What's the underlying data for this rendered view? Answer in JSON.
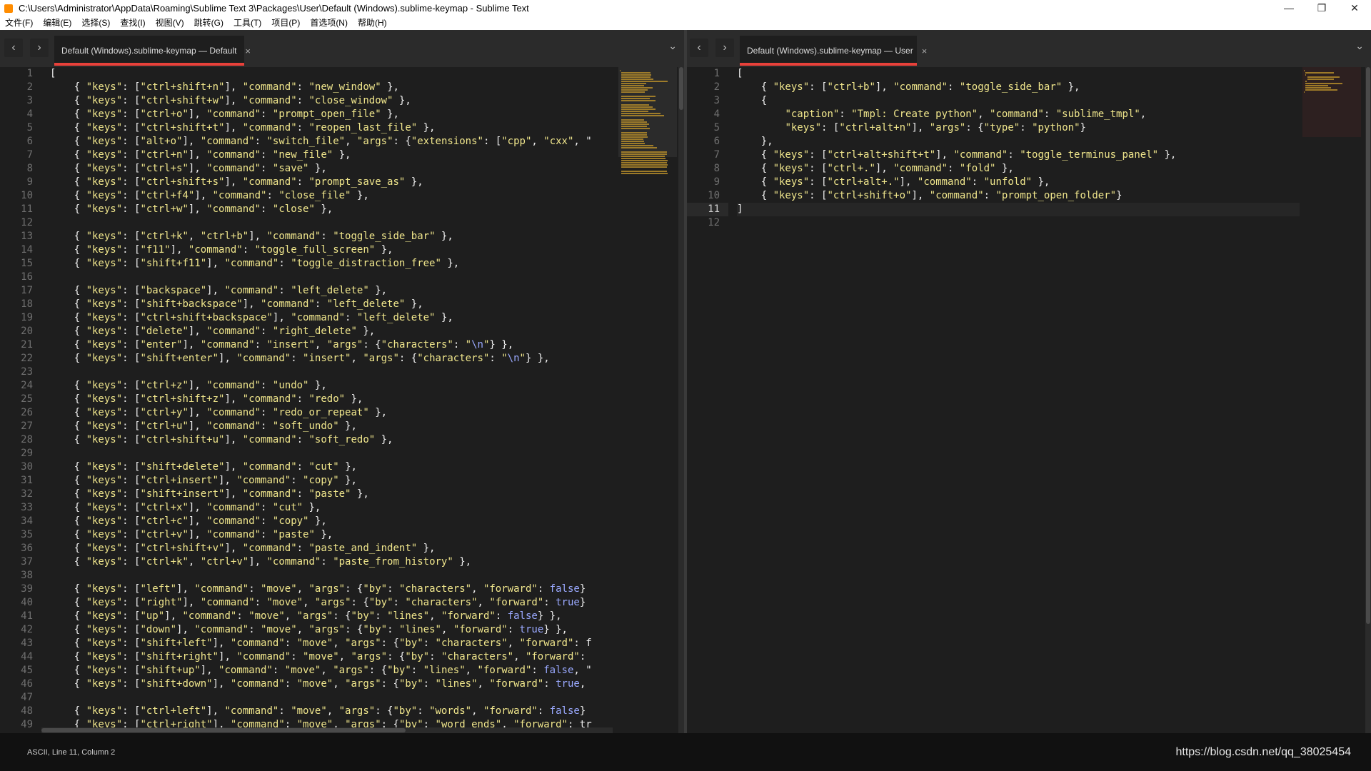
{
  "window": {
    "title": "C:\\Users\\Administrator\\AppData\\Roaming\\Sublime Text 3\\Packages\\User\\Default (Windows).sublime-keymap - Sublime Text",
    "controls": {
      "minimize": "—",
      "restore": "❐",
      "close": "✕"
    }
  },
  "menu": [
    "文件(F)",
    "编辑(E)",
    "选择(S)",
    "查找(I)",
    "视图(V)",
    "跳转(G)",
    "工具(T)",
    "项目(P)",
    "首选项(N)",
    "帮助(H)"
  ],
  "left_tab": {
    "label": "Default (Windows).sublime-keymap — Default",
    "close": "×"
  },
  "right_tab": {
    "label": "Default (Windows).sublime-keymap — User",
    "close": "×"
  },
  "nav": {
    "back": "‹",
    "forward": "›",
    "dropdown": "⌄"
  },
  "left_code": [
    "[",
    "    { \"keys\": [\"ctrl+shift+n\"], \"command\": \"new_window\" },",
    "    { \"keys\": [\"ctrl+shift+w\"], \"command\": \"close_window\" },",
    "    { \"keys\": [\"ctrl+o\"], \"command\": \"prompt_open_file\" },",
    "    { \"keys\": [\"ctrl+shift+t\"], \"command\": \"reopen_last_file\" },",
    "    { \"keys\": [\"alt+o\"], \"command\": \"switch_file\", \"args\": {\"extensions\": [\"cpp\", \"cxx\", \"",
    "    { \"keys\": [\"ctrl+n\"], \"command\": \"new_file\" },",
    "    { \"keys\": [\"ctrl+s\"], \"command\": \"save\" },",
    "    { \"keys\": [\"ctrl+shift+s\"], \"command\": \"prompt_save_as\" },",
    "    { \"keys\": [\"ctrl+f4\"], \"command\": \"close_file\" },",
    "    { \"keys\": [\"ctrl+w\"], \"command\": \"close\" },",
    "",
    "    { \"keys\": [\"ctrl+k\", \"ctrl+b\"], \"command\": \"toggle_side_bar\" },",
    "    { \"keys\": [\"f11\"], \"command\": \"toggle_full_screen\" },",
    "    { \"keys\": [\"shift+f11\"], \"command\": \"toggle_distraction_free\" },",
    "",
    "    { \"keys\": [\"backspace\"], \"command\": \"left_delete\" },",
    "    { \"keys\": [\"shift+backspace\"], \"command\": \"left_delete\" },",
    "    { \"keys\": [\"ctrl+shift+backspace\"], \"command\": \"left_delete\" },",
    "    { \"keys\": [\"delete\"], \"command\": \"right_delete\" },",
    "    { \"keys\": [\"enter\"], \"command\": \"insert\", \"args\": {\"characters\": \"\\n\"} },",
    "    { \"keys\": [\"shift+enter\"], \"command\": \"insert\", \"args\": {\"characters\": \"\\n\"} },",
    "",
    "    { \"keys\": [\"ctrl+z\"], \"command\": \"undo\" },",
    "    { \"keys\": [\"ctrl+shift+z\"], \"command\": \"redo\" },",
    "    { \"keys\": [\"ctrl+y\"], \"command\": \"redo_or_repeat\" },",
    "    { \"keys\": [\"ctrl+u\"], \"command\": \"soft_undo\" },",
    "    { \"keys\": [\"ctrl+shift+u\"], \"command\": \"soft_redo\" },",
    "",
    "    { \"keys\": [\"shift+delete\"], \"command\": \"cut\" },",
    "    { \"keys\": [\"ctrl+insert\"], \"command\": \"copy\" },",
    "    { \"keys\": [\"shift+insert\"], \"command\": \"paste\" },",
    "    { \"keys\": [\"ctrl+x\"], \"command\": \"cut\" },",
    "    { \"keys\": [\"ctrl+c\"], \"command\": \"copy\" },",
    "    { \"keys\": [\"ctrl+v\"], \"command\": \"paste\" },",
    "    { \"keys\": [\"ctrl+shift+v\"], \"command\": \"paste_and_indent\" },",
    "    { \"keys\": [\"ctrl+k\", \"ctrl+v\"], \"command\": \"paste_from_history\" },",
    "",
    "    { \"keys\": [\"left\"], \"command\": \"move\", \"args\": {\"by\": \"characters\", \"forward\": false}",
    "    { \"keys\": [\"right\"], \"command\": \"move\", \"args\": {\"by\": \"characters\", \"forward\": true}",
    "    { \"keys\": [\"up\"], \"command\": \"move\", \"args\": {\"by\": \"lines\", \"forward\": false} },",
    "    { \"keys\": [\"down\"], \"command\": \"move\", \"args\": {\"by\": \"lines\", \"forward\": true} },",
    "    { \"keys\": [\"shift+left\"], \"command\": \"move\", \"args\": {\"by\": \"characters\", \"forward\": f",
    "    { \"keys\": [\"shift+right\"], \"command\": \"move\", \"args\": {\"by\": \"characters\", \"forward\":",
    "    { \"keys\": [\"shift+up\"], \"command\": \"move\", \"args\": {\"by\": \"lines\", \"forward\": false, \"",
    "    { \"keys\": [\"shift+down\"], \"command\": \"move\", \"args\": {\"by\": \"lines\", \"forward\": true,",
    "",
    "    { \"keys\": [\"ctrl+left\"], \"command\": \"move\", \"args\": {\"by\": \"words\", \"forward\": false}",
    "    { \"keys\": [\"ctrl+right\"], \"command\": \"move\", \"args\": {\"by\": \"word_ends\", \"forward\": tr"
  ],
  "right_code": [
    "[",
    "    { \"keys\": [\"ctrl+b\"], \"command\": \"toggle_side_bar\" },",
    "    {",
    "        \"caption\": \"Tmpl: Create python\", \"command\": \"sublime_tmpl\",",
    "        \"keys\": [\"ctrl+alt+n\"], \"args\": {\"type\": \"python\"}",
    "    },",
    "    { \"keys\": [\"ctrl+alt+shift+t\"], \"command\": \"toggle_terminus_panel\" },",
    "    { \"keys\": [\"ctrl+.\"], \"command\": \"fold\" },",
    "    { \"keys\": [\"ctrl+alt+.\"], \"command\": \"unfold\" },",
    "    { \"keys\": [\"ctrl+shift+o\"], \"command\": \"prompt_open_folder\"}",
    "]",
    ""
  ],
  "right_active_line": 11,
  "status": {
    "left": "ASCII, Line 11, Column 2",
    "right": "https://blog.csdn.net/qq_38025454"
  },
  "colors": {
    "accent": "#e8413a",
    "string": "#f0e68c",
    "bool": "#9aa9ff"
  }
}
